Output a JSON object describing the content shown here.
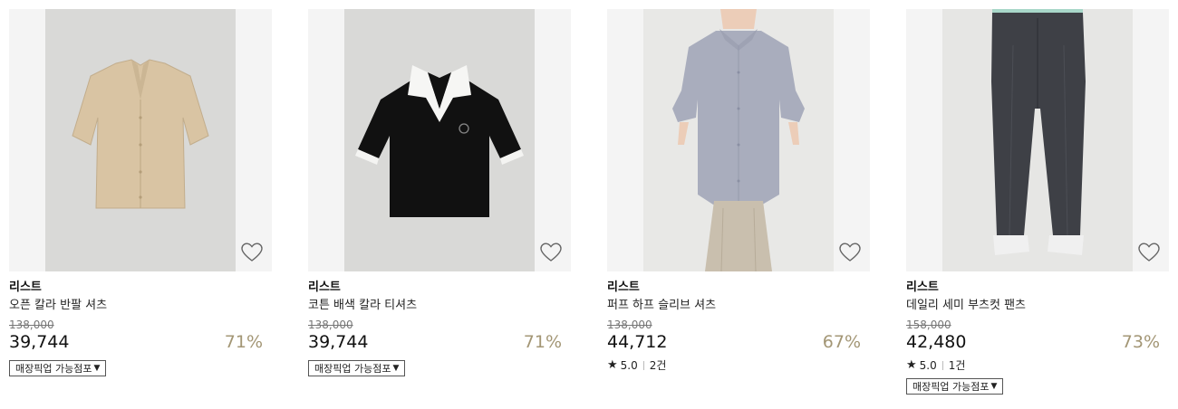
{
  "products": [
    {
      "brand": "리스트",
      "name": "오픈 칼라 반팔 셔츠",
      "original_price": "138,000",
      "price": "39,744",
      "discount": "71%",
      "rating": "",
      "review_count": "",
      "pickup_label": "매장픽업 가능점포",
      "image": "beige-open-collar-shirt"
    },
    {
      "brand": "리스트",
      "name": "코튼 배색 칼라 티셔츠",
      "original_price": "138,000",
      "price": "39,744",
      "discount": "71%",
      "rating": "",
      "review_count": "",
      "pickup_label": "매장픽업 가능점포",
      "image": "black-polo-white-collar"
    },
    {
      "brand": "리스트",
      "name": "퍼프 하프 슬리브 셔츠",
      "original_price": "138,000",
      "price": "44,712",
      "discount": "67%",
      "rating": "5.0",
      "review_count": "2건",
      "pickup_label": "",
      "image": "lavender-puff-sleeve-shirt"
    },
    {
      "brand": "리스트",
      "name": "데일리 세미 부츠컷 팬츠",
      "original_price": "158,000",
      "price": "42,480",
      "discount": "73%",
      "rating": "5.0",
      "review_count": "1건",
      "pickup_label": "매장픽업 가능점포",
      "image": "charcoal-bootcut-pants"
    }
  ],
  "icons": {
    "wishlist": "heart-outline-icon",
    "rating": "star-icon",
    "dropdown": "caret-down-icon"
  },
  "colors": {
    "discount": "#a39675",
    "photo_bg": "#d9d9d7",
    "card_bg": "#f4f4f4"
  }
}
